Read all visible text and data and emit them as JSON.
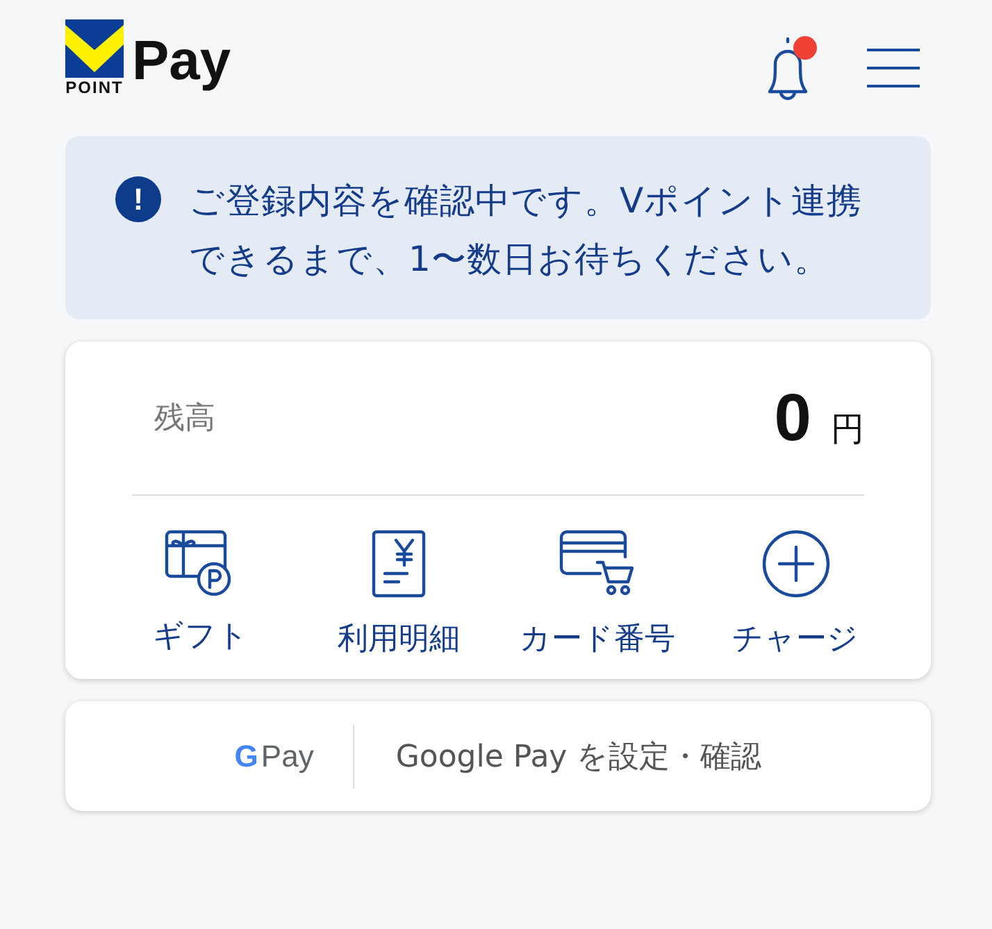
{
  "header": {
    "logo_label": "POINT",
    "logo_text": "Pay",
    "notification_unread": true
  },
  "notice": {
    "icon": "!",
    "message": "ご登録内容を確認中です。Vポイント連携できるまで、1〜数日お待ちください。"
  },
  "balance": {
    "label": "残高",
    "amount": "0",
    "unit": "円"
  },
  "actions": [
    {
      "kind": "gift",
      "label": "ギフト"
    },
    {
      "kind": "statement",
      "label": "利用明細"
    },
    {
      "kind": "card",
      "label": "カード番号"
    },
    {
      "kind": "charge",
      "label": "チャージ"
    }
  ],
  "google_pay": {
    "badge_letter": "G",
    "badge_text": "Pay",
    "label": "Google Pay を設定・確認"
  }
}
